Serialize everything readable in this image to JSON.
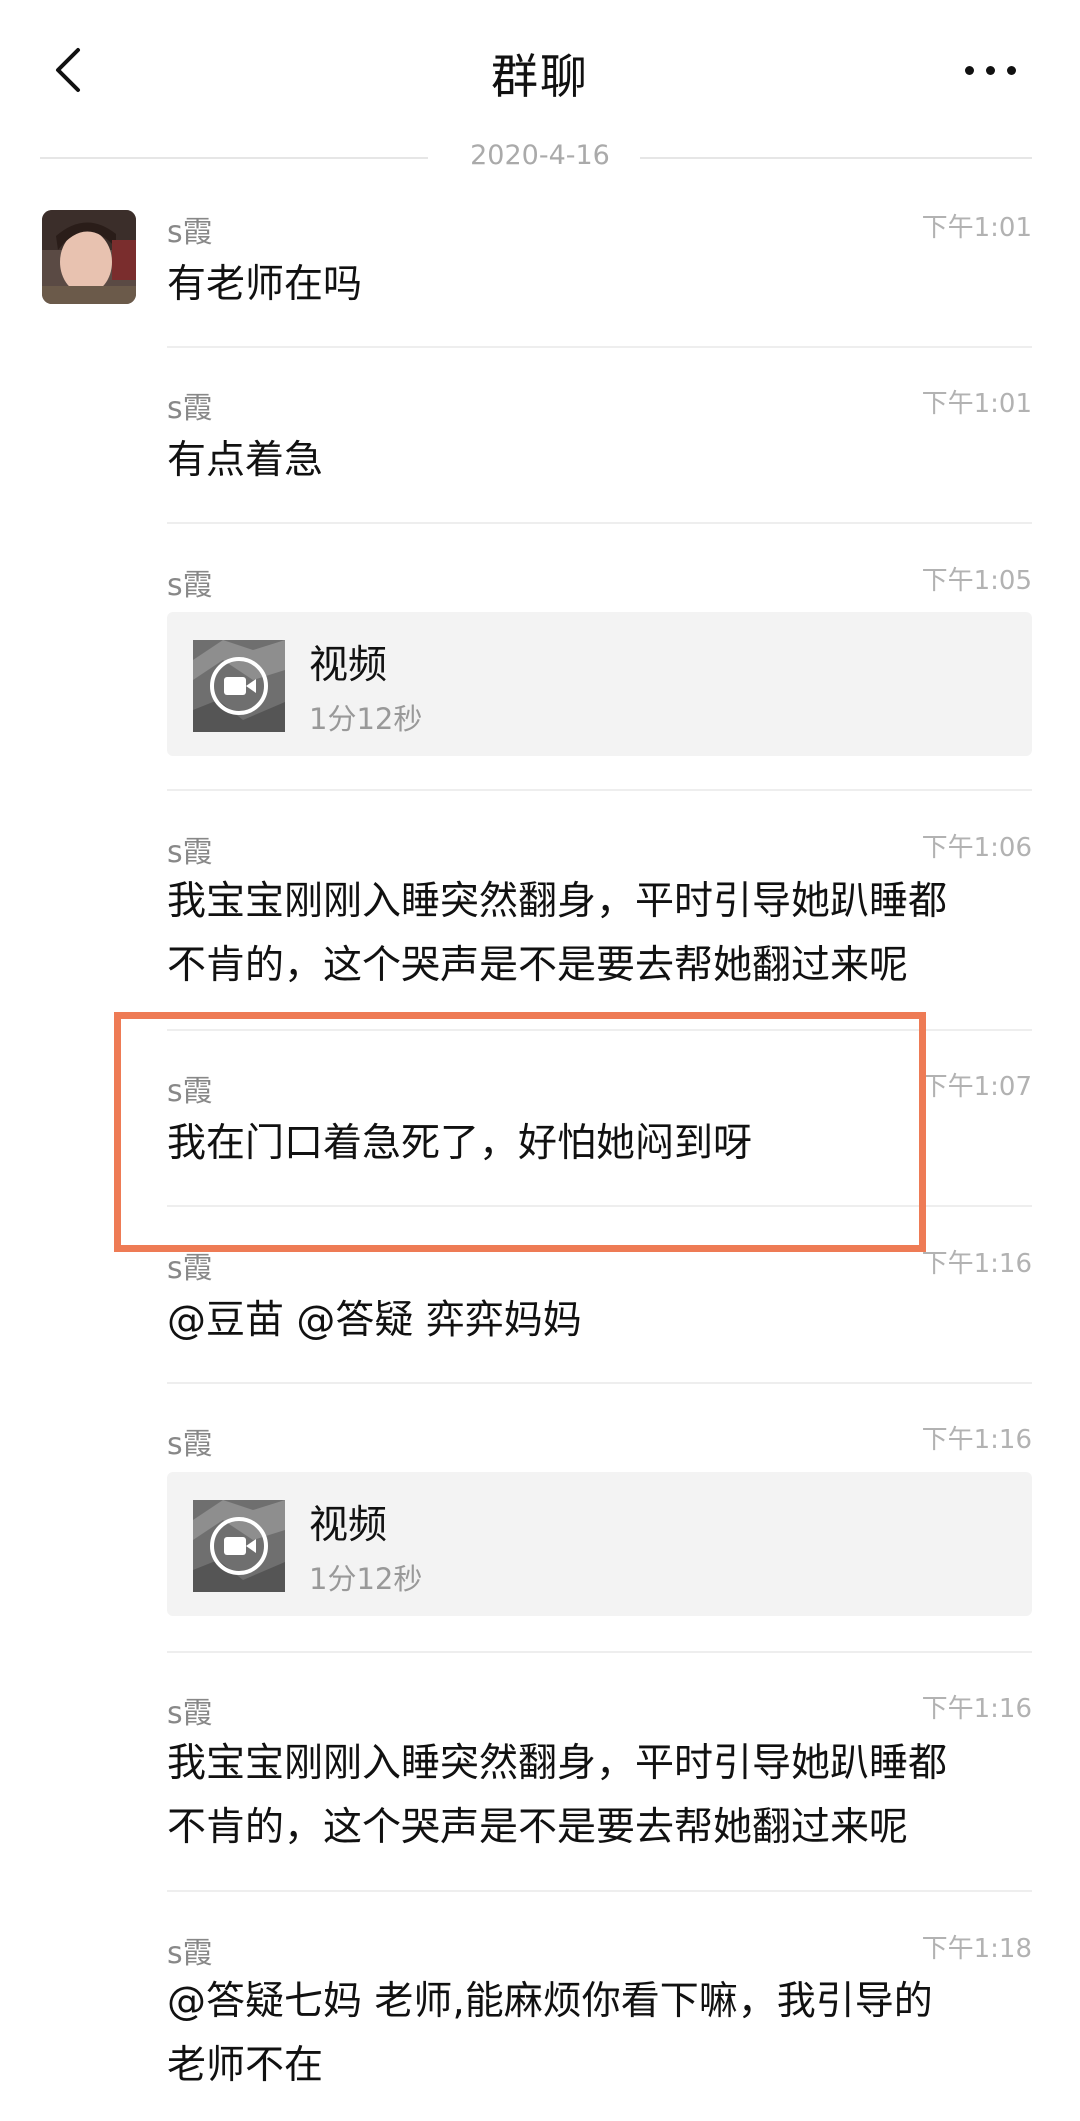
{
  "header": {
    "title": "群聊"
  },
  "date_label": "2020-4-16",
  "messages": [
    {
      "sender": "s霞",
      "time": "下午1:01",
      "text": "有老师在吗"
    },
    {
      "sender": "s霞",
      "time": "下午1:01",
      "text": "有点着急"
    },
    {
      "sender": "s霞",
      "time": "下午1:05",
      "video": {
        "title": "视频",
        "duration": "1分12秒"
      }
    },
    {
      "sender": "s霞",
      "time": "下午1:06",
      "lines": [
        "我宝宝刚刚入睡突然翻身，平时引导她趴睡都",
        "不肯的，这个哭声是不是要去帮她翻过来呢"
      ]
    },
    {
      "sender": "s霞",
      "time": "下午1:07",
      "text": "我在门口着急死了，好怕她闷到呀"
    },
    {
      "sender": "s霞",
      "time": "下午1:16",
      "text": "@豆苗 @答疑 弈弈妈妈"
    },
    {
      "sender": "s霞",
      "time": "下午1:16",
      "video": {
        "title": "视频",
        "duration": "1分12秒"
      }
    },
    {
      "sender": "s霞",
      "time": "下午1:16",
      "lines": [
        "我宝宝刚刚入睡突然翻身，平时引导她趴睡都",
        "不肯的，这个哭声是不是要去帮她翻过来呢"
      ]
    },
    {
      "sender": "s霞",
      "time": "下午1:18",
      "lines": [
        "@答疑七妈 老师,能麻烦你看下嘛，我引导的",
        "老师不在"
      ]
    }
  ],
  "icons": {
    "back": "chevron-left-icon",
    "more": "more-dots-icon",
    "video": "video-camera-icon"
  },
  "colors": {
    "highlight": "#ee7b55",
    "bubble_bg": "#f3f3f3",
    "meta_text": "#888888"
  }
}
